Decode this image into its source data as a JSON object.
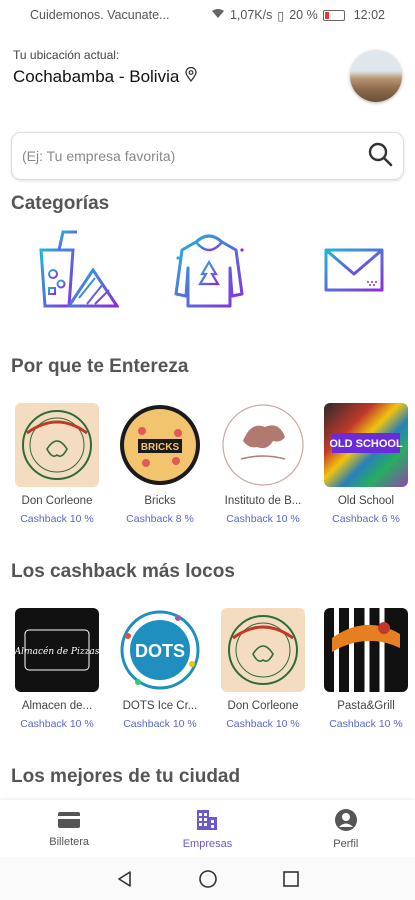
{
  "status_bar": {
    "notification": "Cuidemonos. Vacunate...",
    "speed": "1,07K/s",
    "battery": "20 %",
    "time": "12:02"
  },
  "location": {
    "caption": "Tu ubicación actual:",
    "city": "Cochabamba - Bolivia"
  },
  "search": {
    "placeholder": "(Ej: Tu empresa favorita)"
  },
  "sections": {
    "categories": "Categorías",
    "interest": "Por que te Entereza",
    "cashback": "Los cashback más locos",
    "best": "Los mejores de tu ciudad"
  },
  "categories": [
    {
      "icon": "food-drink-icon"
    },
    {
      "icon": "clothing-hoodie-icon"
    },
    {
      "icon": "mail-envelope-icon"
    }
  ],
  "interest_items": [
    {
      "name": "Don Corleone",
      "cashback": "Cashback 10 %"
    },
    {
      "name": "Bricks",
      "cashback": "Cashback 8 %"
    },
    {
      "name": "Instituto de B...",
      "cashback": "Cashback 10 %"
    },
    {
      "name": "Old School",
      "cashback": "Cashback 6 %"
    }
  ],
  "cashback_items": [
    {
      "name": "Almacen de...",
      "cashback": "Cashback 10 %"
    },
    {
      "name": "DOTS Ice Cr...",
      "cashback": "Cashback 10 %"
    },
    {
      "name": "Don Corleone",
      "cashback": "Cashback 10 %"
    },
    {
      "name": "Pasta&Grill",
      "cashback": "Cashback 10 %"
    }
  ],
  "logos": {
    "bricks": "BRICKS",
    "almacen": "Almacén de Pizzas",
    "dots": "DOTS",
    "old_school": "OLD SCHOOL"
  },
  "bottom_nav": [
    {
      "label": "Billetera",
      "icon": "wallet-icon"
    },
    {
      "label": "Empresas",
      "icon": "buildings-icon"
    },
    {
      "label": "Perfil",
      "icon": "profile-icon"
    }
  ],
  "colors": {
    "accent": "#6a5acd",
    "cashback": "#5a67c9"
  }
}
